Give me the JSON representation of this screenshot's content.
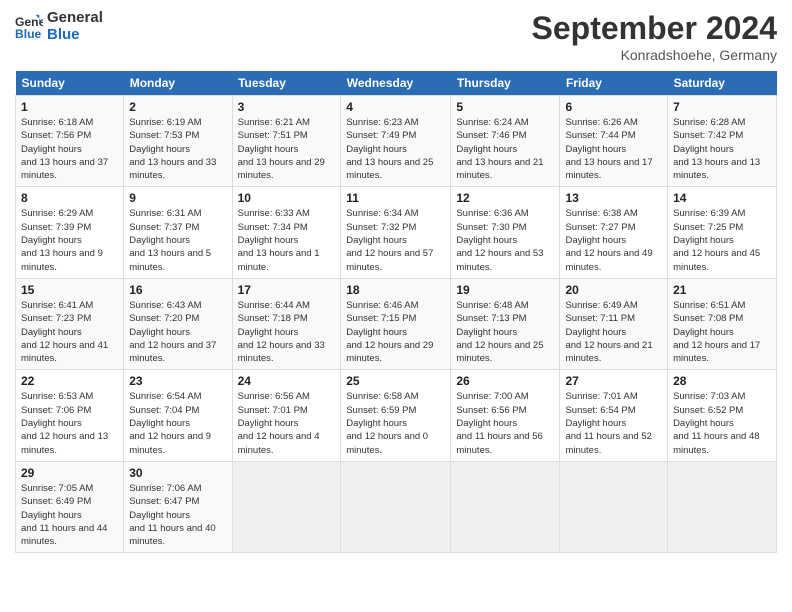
{
  "header": {
    "logo_line1": "General",
    "logo_line2": "Blue",
    "month": "September 2024",
    "location": "Konradshoehe, Germany"
  },
  "weekdays": [
    "Sunday",
    "Monday",
    "Tuesday",
    "Wednesday",
    "Thursday",
    "Friday",
    "Saturday"
  ],
  "weeks": [
    [
      {
        "day": "1",
        "sunrise": "6:18 AM",
        "sunset": "7:56 PM",
        "daylight": "13 hours and 37 minutes."
      },
      {
        "day": "2",
        "sunrise": "6:19 AM",
        "sunset": "7:53 PM",
        "daylight": "13 hours and 33 minutes."
      },
      {
        "day": "3",
        "sunrise": "6:21 AM",
        "sunset": "7:51 PM",
        "daylight": "13 hours and 29 minutes."
      },
      {
        "day": "4",
        "sunrise": "6:23 AM",
        "sunset": "7:49 PM",
        "daylight": "13 hours and 25 minutes."
      },
      {
        "day": "5",
        "sunrise": "6:24 AM",
        "sunset": "7:46 PM",
        "daylight": "13 hours and 21 minutes."
      },
      {
        "day": "6",
        "sunrise": "6:26 AM",
        "sunset": "7:44 PM",
        "daylight": "13 hours and 17 minutes."
      },
      {
        "day": "7",
        "sunrise": "6:28 AM",
        "sunset": "7:42 PM",
        "daylight": "13 hours and 13 minutes."
      }
    ],
    [
      {
        "day": "8",
        "sunrise": "6:29 AM",
        "sunset": "7:39 PM",
        "daylight": "13 hours and 9 minutes."
      },
      {
        "day": "9",
        "sunrise": "6:31 AM",
        "sunset": "7:37 PM",
        "daylight": "13 hours and 5 minutes."
      },
      {
        "day": "10",
        "sunrise": "6:33 AM",
        "sunset": "7:34 PM",
        "daylight": "13 hours and 1 minute."
      },
      {
        "day": "11",
        "sunrise": "6:34 AM",
        "sunset": "7:32 PM",
        "daylight": "12 hours and 57 minutes."
      },
      {
        "day": "12",
        "sunrise": "6:36 AM",
        "sunset": "7:30 PM",
        "daylight": "12 hours and 53 minutes."
      },
      {
        "day": "13",
        "sunrise": "6:38 AM",
        "sunset": "7:27 PM",
        "daylight": "12 hours and 49 minutes."
      },
      {
        "day": "14",
        "sunrise": "6:39 AM",
        "sunset": "7:25 PM",
        "daylight": "12 hours and 45 minutes."
      }
    ],
    [
      {
        "day": "15",
        "sunrise": "6:41 AM",
        "sunset": "7:23 PM",
        "daylight": "12 hours and 41 minutes."
      },
      {
        "day": "16",
        "sunrise": "6:43 AM",
        "sunset": "7:20 PM",
        "daylight": "12 hours and 37 minutes."
      },
      {
        "day": "17",
        "sunrise": "6:44 AM",
        "sunset": "7:18 PM",
        "daylight": "12 hours and 33 minutes."
      },
      {
        "day": "18",
        "sunrise": "6:46 AM",
        "sunset": "7:15 PM",
        "daylight": "12 hours and 29 minutes."
      },
      {
        "day": "19",
        "sunrise": "6:48 AM",
        "sunset": "7:13 PM",
        "daylight": "12 hours and 25 minutes."
      },
      {
        "day": "20",
        "sunrise": "6:49 AM",
        "sunset": "7:11 PM",
        "daylight": "12 hours and 21 minutes."
      },
      {
        "day": "21",
        "sunrise": "6:51 AM",
        "sunset": "7:08 PM",
        "daylight": "12 hours and 17 minutes."
      }
    ],
    [
      {
        "day": "22",
        "sunrise": "6:53 AM",
        "sunset": "7:06 PM",
        "daylight": "12 hours and 13 minutes."
      },
      {
        "day": "23",
        "sunrise": "6:54 AM",
        "sunset": "7:04 PM",
        "daylight": "12 hours and 9 minutes."
      },
      {
        "day": "24",
        "sunrise": "6:56 AM",
        "sunset": "7:01 PM",
        "daylight": "12 hours and 4 minutes."
      },
      {
        "day": "25",
        "sunrise": "6:58 AM",
        "sunset": "6:59 PM",
        "daylight": "12 hours and 0 minutes."
      },
      {
        "day": "26",
        "sunrise": "7:00 AM",
        "sunset": "6:56 PM",
        "daylight": "11 hours and 56 minutes."
      },
      {
        "day": "27",
        "sunrise": "7:01 AM",
        "sunset": "6:54 PM",
        "daylight": "11 hours and 52 minutes."
      },
      {
        "day": "28",
        "sunrise": "7:03 AM",
        "sunset": "6:52 PM",
        "daylight": "11 hours and 48 minutes."
      }
    ],
    [
      {
        "day": "29",
        "sunrise": "7:05 AM",
        "sunset": "6:49 PM",
        "daylight": "11 hours and 44 minutes."
      },
      {
        "day": "30",
        "sunrise": "7:06 AM",
        "sunset": "6:47 PM",
        "daylight": "11 hours and 40 minutes."
      },
      null,
      null,
      null,
      null,
      null
    ]
  ]
}
